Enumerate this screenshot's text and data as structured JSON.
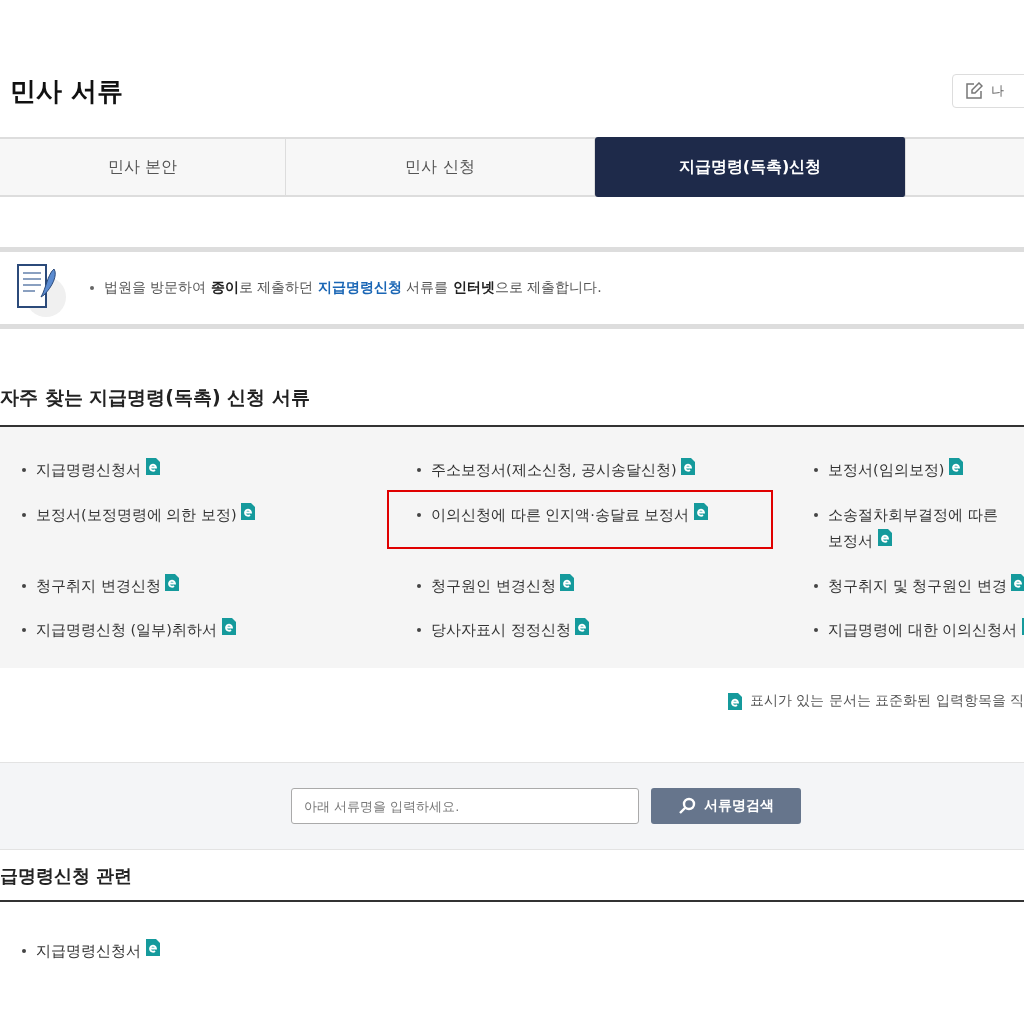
{
  "page_title": "민사 서류",
  "header_button": {
    "label": "나"
  },
  "tabs": [
    {
      "label": "민사 본안",
      "selected": false
    },
    {
      "label": "민사 신청",
      "selected": false
    },
    {
      "label": "지급명령(독촉)신청",
      "selected": true
    },
    {
      "selected": false
    }
  ],
  "notice": {
    "parts": [
      "법원을 방문하여 **종이**로 제출하던 ",
      "지급명령신청",
      " 서류를 **인터넷**으로 제출합니다."
    ]
  },
  "frequent": {
    "title": "자주 찾는 지급명령(독촉) 신청 서류",
    "items": [
      {
        "lines": [
          "지급명령신청서"
        ],
        "highlighted": false
      },
      {
        "lines": [
          "주소보정서(제소신청, 공시송달신청)"
        ],
        "highlighted": false
      },
      {
        "lines": [
          "보정서(임의보정)"
        ],
        "highlighted": false
      },
      {
        "lines": [
          "보정서(보정명령에 의한 보정)"
        ],
        "highlighted": false
      },
      {
        "lines": [
          "이의신청에 따른 인지액·송달료 보정서"
        ],
        "highlighted": true
      },
      {
        "lines": [
          "소송절차회부결정에 따른",
          "보정서"
        ],
        "highlighted": false
      },
      {
        "lines": [
          "청구취지 변경신청"
        ],
        "highlighted": false
      },
      {
        "lines": [
          "청구원인 변경신청"
        ],
        "highlighted": false
      },
      {
        "lines": [
          "청구취지 및 청구원인 변경"
        ],
        "highlighted": false
      },
      {
        "lines": [
          "지급명령신청 (일부)취하서"
        ],
        "highlighted": false
      },
      {
        "lines": [
          "당사자표시 정정신청"
        ],
        "highlighted": false
      },
      {
        "lines": [
          "지급명령에 대한 이의신청서"
        ],
        "highlighted": false
      }
    ]
  },
  "legend": "표시가 있는 문서는 표준화된 입력항목을 직",
  "search": {
    "placeholder": "아래 서류명을 입력하세요.",
    "button": "서류명검색"
  },
  "related": {
    "title": "급명령신청 관련",
    "items": [
      {
        "lines": [
          "지급명령신청서"
        ]
      }
    ]
  }
}
